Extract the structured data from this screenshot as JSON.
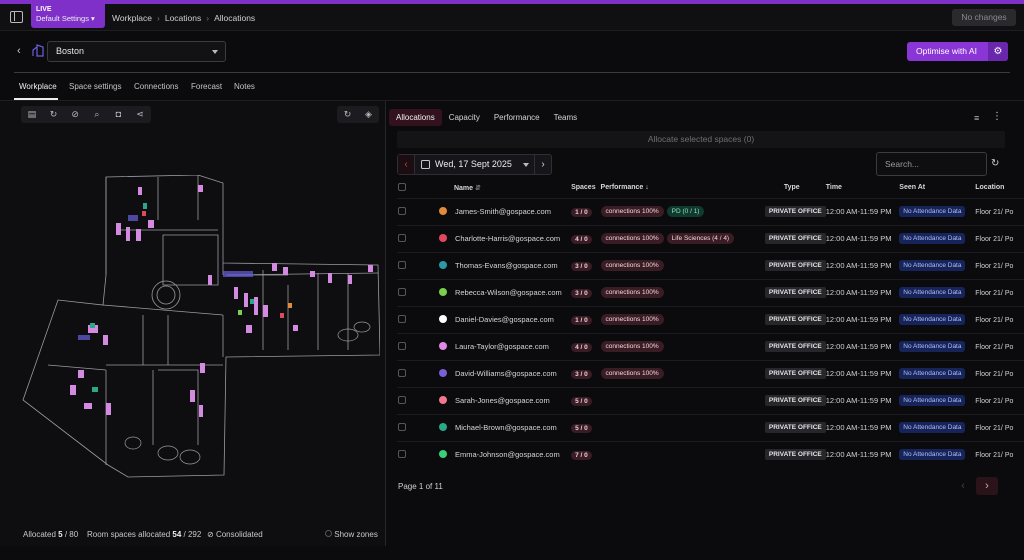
{
  "topbar": {
    "env_label": "LIVE",
    "settings_label": "Default Settings ▾",
    "breadcrumb": [
      "Workplace",
      "Locations",
      "Allocations"
    ],
    "no_changes": "No changes"
  },
  "location": {
    "selected": "Boston",
    "optimise_label": "Optimise with AI"
  },
  "tabs": [
    "Workplace",
    "Space settings",
    "Connections",
    "Forecast",
    "Notes"
  ],
  "map": {
    "footer": {
      "allocated_label": "Allocated",
      "allocated_value": "5",
      "allocated_total": "/ 80",
      "room_label": "Room spaces allocated",
      "room_value": "54",
      "room_total": "/ 292",
      "consolidated": "Consolidated",
      "show_zones": "Show zones"
    }
  },
  "allocations": {
    "subtabs": [
      "Allocations",
      "Capacity",
      "Performance",
      "Teams"
    ],
    "allocate_bar": "Allocate selected spaces",
    "allocate_count": "(0)",
    "date": "Wed, 17 Sept 2025",
    "search_placeholder": "Search...",
    "columns": {
      "name": "Name",
      "spaces": "Spaces",
      "performance": "Performance",
      "type": "Type",
      "time": "Time",
      "seen_at": "Seen At",
      "location": "Location"
    },
    "rows": [
      {
        "color": "#e08a3a",
        "email": "James-Smith@gospace.com",
        "spaces": "1 / 0",
        "perf": [
          "connections 100%"
        ],
        "perf2": "PD (0 / 1)",
        "type": "PRIVATE OFFICE",
        "time": "12:00 AM-11:59 PM",
        "seen": "No Attendance Data",
        "location": "Floor 21/ Po"
      },
      {
        "color": "#e0485e",
        "email": "Charlotte-Harris@gospace.com",
        "spaces": "4 / 0",
        "perf": [
          "connections 100%"
        ],
        "perf2": "Life Sciences (4 / 4)",
        "type": "PRIVATE OFFICE",
        "time": "12:00 AM-11:59 PM",
        "seen": "No Attendance Data",
        "location": "Floor 21/ Po"
      },
      {
        "color": "#2a9aa6",
        "email": "Thomas-Evans@gospace.com",
        "spaces": "3 / 0",
        "perf": [
          "connections 100%"
        ],
        "perf2": "",
        "type": "PRIVATE OFFICE",
        "time": "12:00 AM-11:59 PM",
        "seen": "No Attendance Data",
        "location": "Floor 21/ Po"
      },
      {
        "color": "#7ad04a",
        "email": "Rebecca-Wilson@gospace.com",
        "spaces": "3 / 0",
        "perf": [
          "connections 100%"
        ],
        "perf2": "",
        "type": "PRIVATE OFFICE",
        "time": "12:00 AM-11:59 PM",
        "seen": "No Attendance Data",
        "location": "Floor 21/ Po"
      },
      {
        "color": "#ffffff",
        "email": "Daniel-Davies@gospace.com",
        "spaces": "1 / 0",
        "perf": [
          "connections 100%"
        ],
        "perf2": "",
        "type": "PRIVATE OFFICE",
        "time": "12:00 AM-11:59 PM",
        "seen": "No Attendance Data",
        "location": "Floor 21/ Po"
      },
      {
        "color": "#e08ae8",
        "email": "Laura-Taylor@gospace.com",
        "spaces": "4 / 0",
        "perf": [
          "connections 100%"
        ],
        "perf2": "",
        "type": "PRIVATE OFFICE",
        "time": "12:00 AM-11:59 PM",
        "seen": "No Attendance Data",
        "location": "Floor 21/ Po"
      },
      {
        "color": "#7a5ed8",
        "email": "David-Williams@gospace.com",
        "spaces": "3 / 0",
        "perf": [
          "connections 100%"
        ],
        "perf2": "",
        "type": "PRIVATE OFFICE",
        "time": "12:00 AM-11:59 PM",
        "seen": "No Attendance Data",
        "location": "Floor 21/ Po"
      },
      {
        "color": "#f0788a",
        "email": "Sarah-Jones@gospace.com",
        "spaces": "5 / 0",
        "perf": [],
        "perf2": "",
        "type": "PRIVATE OFFICE",
        "time": "12:00 AM-11:59 PM",
        "seen": "No Attendance Data",
        "location": "Floor 21/ Po"
      },
      {
        "color": "#2aa68a",
        "email": "Michael-Brown@gospace.com",
        "spaces": "5 / 0",
        "perf": [],
        "perf2": "",
        "type": "PRIVATE OFFICE",
        "time": "12:00 AM-11:59 PM",
        "seen": "No Attendance Data",
        "location": "Floor 21/ Po"
      },
      {
        "color": "#3ad07a",
        "email": "Emma-Johnson@gospace.com",
        "spaces": "7 / 0",
        "perf": [],
        "perf2": "",
        "type": "PRIVATE OFFICE",
        "time": "12:00 AM-11:59 PM",
        "seen": "No Attendance Data",
        "location": "Floor 21/ Po"
      }
    ],
    "pager": "Page 1 of 11"
  },
  "accent_color": "#8a35d6"
}
